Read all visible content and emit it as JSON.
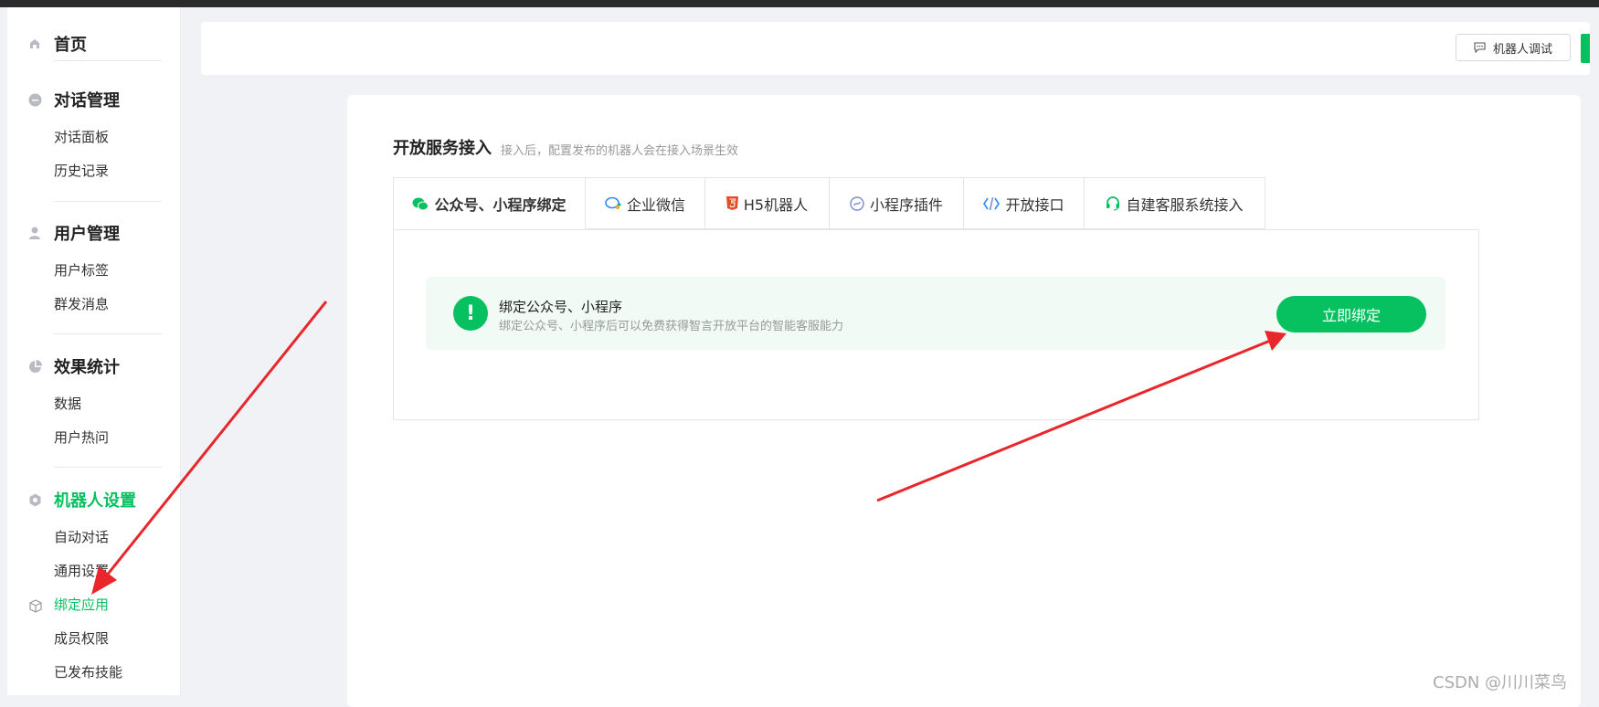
{
  "sidebar": {
    "home": {
      "label": "首页",
      "icon": "home-icon"
    },
    "groups": [
      {
        "label": "对话管理",
        "icon": "chat-circle-icon",
        "items": [
          "对话面板",
          "历史记录"
        ]
      },
      {
        "label": "用户管理",
        "icon": "user-icon",
        "items": [
          "用户标签",
          "群发消息"
        ]
      },
      {
        "label": "效果统计",
        "icon": "pie-chart-icon",
        "items": [
          "数据",
          "用户热问"
        ]
      },
      {
        "label": "机器人设置",
        "icon": "gear-icon",
        "items": [
          "自动对话",
          "通用设置",
          "绑定应用",
          "成员权限",
          "已发布技能"
        ],
        "active_item": "绑定应用"
      }
    ]
  },
  "header": {
    "debug_button": "机器人调试"
  },
  "main": {
    "title": "开放服务接入",
    "subtitle": "接入后，配置发布的机器人会在接入场景生效",
    "tabs": [
      {
        "label": "公众号、小程序绑定",
        "icon": "wechat-icon",
        "active": true
      },
      {
        "label": "企业微信",
        "icon": "wecom-icon"
      },
      {
        "label": "H5机器人",
        "icon": "html5-icon"
      },
      {
        "label": "小程序插件",
        "icon": "miniprogram-icon"
      },
      {
        "label": "开放接口",
        "icon": "code-icon"
      },
      {
        "label": "自建客服系统接入",
        "icon": "headset-icon"
      }
    ],
    "notice": {
      "badge": "!",
      "title": "绑定公众号、小程序",
      "desc": "绑定公众号、小程序后可以免费获得智言开放平台的智能客服能力",
      "button": "立即绑定"
    }
  },
  "watermark": "CSDN @川川菜鸟",
  "colors": {
    "accent": "#07c160",
    "annotation_arrow": "#e8262b"
  }
}
